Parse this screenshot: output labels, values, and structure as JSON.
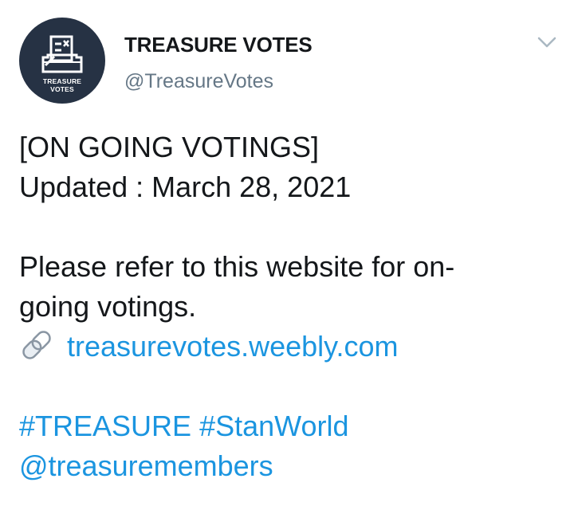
{
  "account": {
    "display_name": "TREASURE VOTES",
    "handle": "@TreasureVotes",
    "avatar_line1": "TREASURE",
    "avatar_line2": "VOTES"
  },
  "tweet": {
    "line1": "[ON GOING VOTINGS]",
    "line2": "Updated : March 28, 2021",
    "line3": "Please refer to this website for on-",
    "line4": "going votings.",
    "link_icon": "link-icon",
    "link_text": "treasurevotes.weebly.com",
    "hashtags": [
      "#TREASURE",
      "#StanWorld"
    ],
    "mention": "@treasuremembers"
  },
  "icons": {
    "menu": "chevron-down-icon",
    "avatar": "ballot-box-icon"
  },
  "colors": {
    "link": "#1b95e0",
    "handle": "#657786",
    "text": "#14171a",
    "avatar_bg": "#263244"
  }
}
